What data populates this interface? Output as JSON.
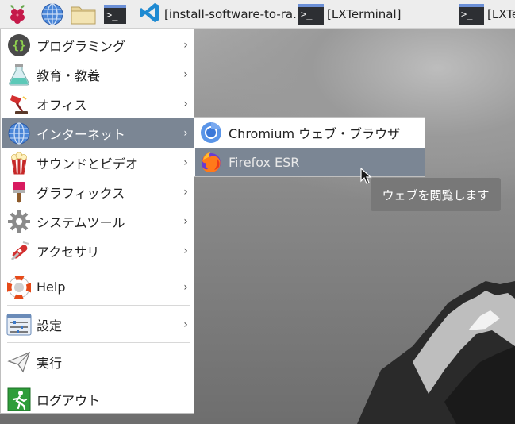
{
  "taskbar": {
    "launchers": [
      {
        "icon": "raspberry-pi-icon"
      },
      {
        "icon": "web-browser-globe-icon"
      },
      {
        "icon": "file-manager-folder-icon"
      },
      {
        "icon": "terminal-icon",
        "glyph": ">_"
      }
    ],
    "tasks": [
      {
        "icon": "vscode-icon",
        "label": "[install-software-to-ra..."
      },
      {
        "icon": "terminal-icon",
        "glyph": ">_",
        "label": "[LXTerminal]"
      },
      {
        "icon": "terminal-icon",
        "glyph": ">_",
        "label": "[LXTe"
      }
    ]
  },
  "main_menu": {
    "items": [
      {
        "label": "プログラミング",
        "icon": "programming-braces-icon",
        "has_submenu": true
      },
      {
        "label": "教育・教養",
        "icon": "education-flask-icon",
        "has_submenu": true
      },
      {
        "label": "オフィス",
        "icon": "office-lamp-icon",
        "has_submenu": true
      },
      {
        "label": "インターネット",
        "icon": "internet-globe-icon",
        "has_submenu": true,
        "active": true
      },
      {
        "label": "サウンドとビデオ",
        "icon": "sound-video-popcorn-icon",
        "has_submenu": true
      },
      {
        "label": "グラフィックス",
        "icon": "graphics-brush-icon",
        "has_submenu": true
      },
      {
        "label": "システムツール",
        "icon": "system-tools-gear-icon",
        "has_submenu": true
      },
      {
        "label": "アクセサリ",
        "icon": "accessories-knife-icon",
        "has_submenu": true
      },
      {
        "label": "Help",
        "icon": "help-lifebuoy-icon",
        "has_submenu": true
      },
      {
        "label": "設定",
        "icon": "settings-sliders-icon",
        "has_submenu": true
      },
      {
        "label": "実行",
        "icon": "run-paper-plane-icon",
        "has_submenu": false
      },
      {
        "label": "ログアウト",
        "icon": "logout-exit-icon",
        "has_submenu": false
      }
    ],
    "arrow_glyph": "›"
  },
  "internet_submenu": {
    "items": [
      {
        "label": "Chromium ウェブ・ブラウザ",
        "icon": "chromium-icon"
      },
      {
        "label": "Firefox ESR",
        "icon": "firefox-icon",
        "active": true
      }
    ]
  },
  "tooltip": {
    "text": "ウェブを閲覧します"
  },
  "colors": {
    "menu_highlight": "#7b8694",
    "taskbar_bg": "#ededed",
    "tooltip_bg": "#787878"
  }
}
